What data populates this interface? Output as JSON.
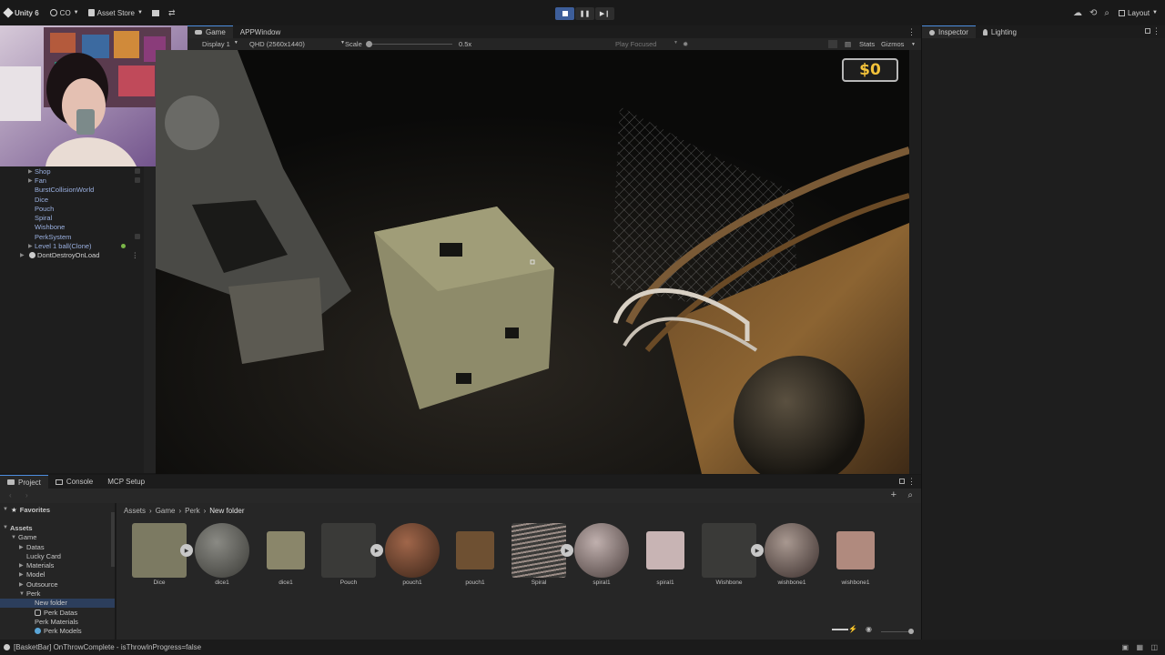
{
  "toolbar": {
    "app_name": "Unity 6",
    "account": "CO",
    "asset_store": "Asset Store",
    "layout": "Layout"
  },
  "hierarchy": {
    "items": [
      {
        "label": "Shop"
      },
      {
        "label": "Fan"
      },
      {
        "label": "BurstCollisionWorld"
      },
      {
        "label": "Dice"
      },
      {
        "label": "Pouch"
      },
      {
        "label": "Spiral"
      },
      {
        "label": "Wishbone"
      },
      {
        "label": "PerkSystem"
      },
      {
        "label": "Level 1 ball(Clone)"
      },
      {
        "label": "DontDestroyOnLoad"
      }
    ]
  },
  "game_view": {
    "tabs": [
      {
        "label": "Game"
      },
      {
        "label": "APPWindow"
      }
    ],
    "display": "Display 1",
    "resolution": "QHD (2560x1440)",
    "scale_label": "Scale",
    "scale_value": "0.5x",
    "play_focused": "Play Focused",
    "stats": "Stats",
    "gizmos": "Gizmos",
    "money": "$0"
  },
  "inspector": {
    "tabs": [
      {
        "label": "Inspector"
      },
      {
        "label": "Lighting"
      }
    ]
  },
  "project": {
    "tabs": [
      {
        "label": "Project"
      },
      {
        "label": "Console"
      },
      {
        "label": "MCP Setup"
      }
    ],
    "favorites": "Favorites",
    "tree": [
      {
        "label": "Assets"
      },
      {
        "label": "Game"
      },
      {
        "label": "Datas"
      },
      {
        "label": "Lucky Card"
      },
      {
        "label": "Materials"
      },
      {
        "label": "Model"
      },
      {
        "label": "Outsource"
      },
      {
        "label": "Perk"
      },
      {
        "label": "New folder"
      },
      {
        "label": "Perk Datas"
      },
      {
        "label": "Perk Materials"
      },
      {
        "label": "Perk Models"
      }
    ],
    "breadcrumb": [
      "Assets",
      "Game",
      "Perk",
      "New folder"
    ],
    "assets": [
      {
        "label": "Dice"
      },
      {
        "label": "dice1"
      },
      {
        "label": "dice1"
      },
      {
        "label": "Pouch"
      },
      {
        "label": "pouch1"
      },
      {
        "label": "pouch1"
      },
      {
        "label": "Spiral"
      },
      {
        "label": "spiral1"
      },
      {
        "label": "spiral1"
      },
      {
        "label": "Wishbone"
      },
      {
        "label": "wishbone1"
      },
      {
        "label": "wishbone1"
      }
    ]
  },
  "status": {
    "message": "[BasketBar] OnThrowComplete - isThrowInProgress=false"
  },
  "colors": {
    "accent": "#4d8ee0",
    "money": "#f3c23a",
    "play_active": "#3d5e9a"
  }
}
